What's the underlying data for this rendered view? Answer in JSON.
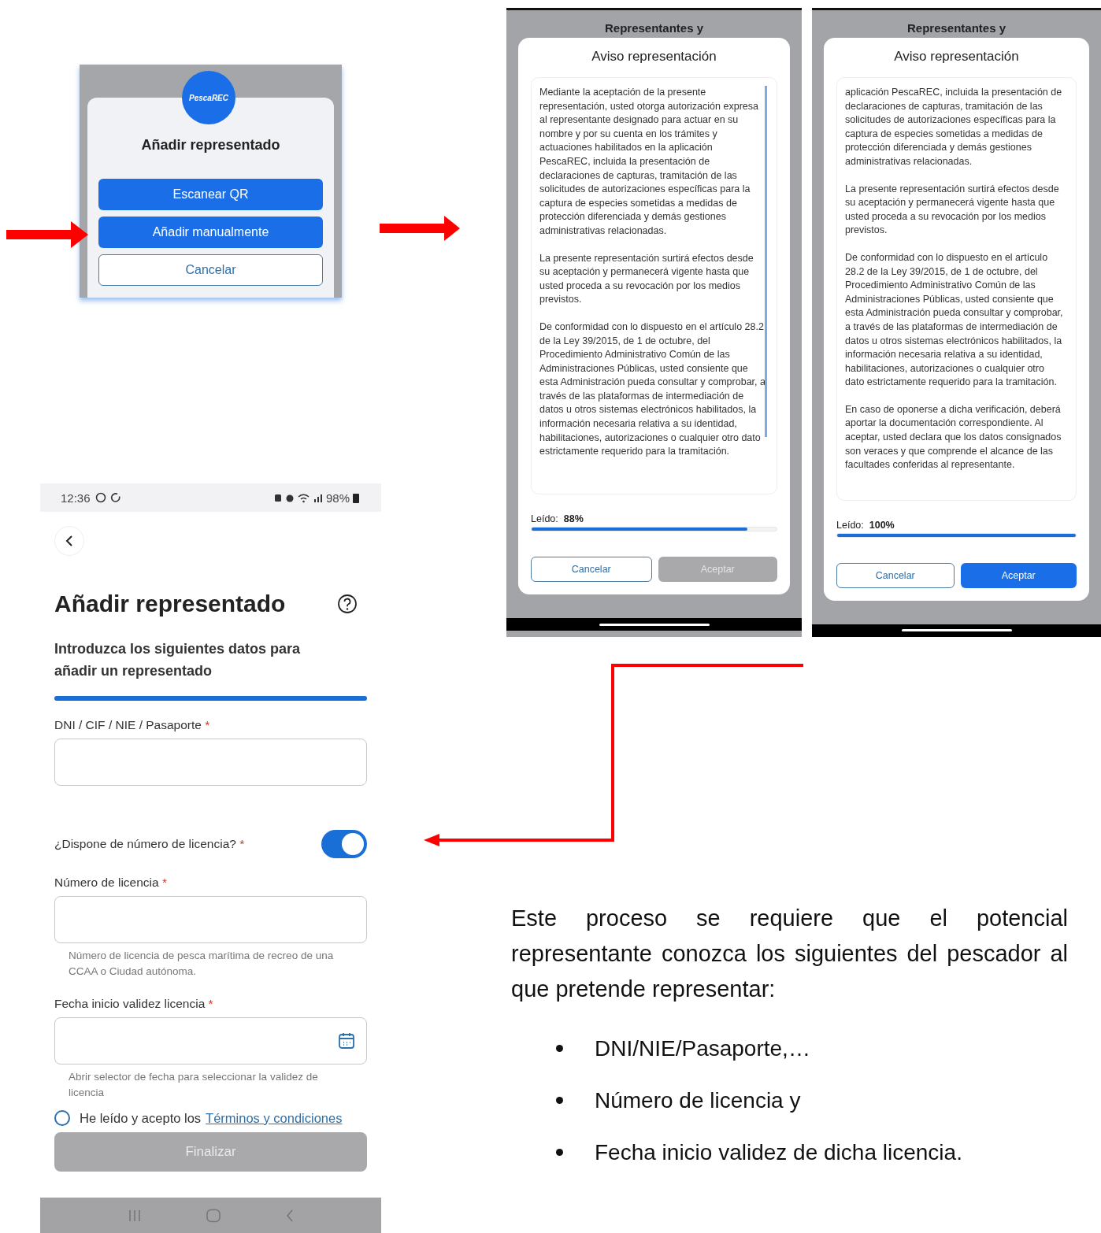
{
  "popup": {
    "logo": "PescaREC",
    "title": "Añadir representado",
    "buttons": [
      {
        "label": "Escanear QR",
        "kind": "primary"
      },
      {
        "label": "Añadir manualmente",
        "kind": "primary"
      },
      {
        "label": "Cancelar",
        "kind": "outline"
      }
    ]
  },
  "notice_screens": [
    {
      "header": "Representantes y",
      "title": "Aviso representación",
      "paragraphs": [
        "Mediante la aceptación de la presente representación, usted otorga autorización expresa al representante designado para actuar en su nombre y por su cuenta en los trámites y actuaciones habilitados en la aplicación PescaREC, incluida la presentación de declaraciones de capturas, tramitación de las solicitudes de autorizaciones específicas para la captura de especies sometidas a medidas de protección diferenciada y demás gestiones administrativas relacionadas.",
        "La presente representación surtirá efectos desde su aceptación y permanecerá vigente hasta que usted proceda a su revocación por los medios previstos.",
        "De conformidad con lo dispuesto en el artículo 28.2 de la Ley 39/2015, de 1 de octubre, del Procedimiento Administrativo Común de las Administraciones Públicas, usted consiente que esta Administración pueda consultar y comprobar, a través de las plataformas de intermediación de datos u otros sistemas electrónicos habilitados, la información necesaria relativa a su identidad, habilitaciones, autorizaciones o cualquier otro dato estrictamente requerido para la tramitación."
      ],
      "read_label": "Leído:",
      "read_value": "88%",
      "level": 0.88,
      "buttons": [
        {
          "label": "Cancelar",
          "kind": "outline",
          "disabled": false
        },
        {
          "label": "Aceptar",
          "kind": "primary",
          "disabled": true
        }
      ]
    },
    {
      "header": "Representantes y",
      "title": "Aviso representación",
      "paragraphs": [
        "aplicación PescaREC, incluida la presentación de declaraciones de capturas, tramitación de las solicitudes de autorizaciones específicas para la captura de especies sometidas a medidas de protección diferenciada y demás gestiones administrativas relacionadas.",
        "La presente representación surtirá efectos desde su aceptación y permanecerá vigente hasta que usted proceda a su revocación por los medios previstos.",
        "De conformidad con lo dispuesto en el artículo 28.2 de la Ley 39/2015, de 1 de octubre, del Procedimiento Administrativo Común de las Administraciones Públicas, usted consiente que esta Administración pueda consultar y comprobar, a través de las plataformas de intermediación de datos u otros sistemas electrónicos habilitados, la información necesaria relativa a su identidad, habilitaciones, autorizaciones o cualquier otro dato estrictamente requerido para la tramitación.",
        "En caso de oponerse a dicha verificación, deberá aportar la documentación correspondiente. Al aceptar, usted declara que los datos consignados son veraces y que comprende el alcance de las facultades conferidas al representante."
      ],
      "read_label": "Leído:",
      "read_value": "100%",
      "level": 1,
      "buttons": [
        {
          "label": "Cancelar",
          "kind": "outline",
          "disabled": false
        },
        {
          "label": "Aceptar",
          "kind": "primary",
          "disabled": false
        }
      ]
    }
  ],
  "form": {
    "status_bar": {
      "time": "12:36",
      "battery": "98%"
    },
    "title": "Añadir representado",
    "subtitle": "Introduzca los siguientes datos para añadir un representado",
    "progress": {
      "level": 1
    },
    "fields": [
      {
        "kind": "text",
        "label": "DNI / CIF / NIE / Pasaporte",
        "asterisk": "*"
      },
      {
        "kind": "toggle",
        "label": "¿Dispone de número de licencia?",
        "asterisk": "*",
        "on": true
      },
      {
        "kind": "text",
        "label": "Número de licencia",
        "asterisk": "*",
        "hint": "Número de licencia de pesca marítima de recreo de una CCAA o Ciudad autónoma."
      },
      {
        "kind": "date",
        "label": "Fecha inicio validez licencia",
        "asterisk": "*",
        "hint": "Abrir selector de fecha para seleccionar la validez de licencia"
      }
    ],
    "terms": {
      "checked": false,
      "text": "He leído y acepto los",
      "link": "Términos y condiciones"
    },
    "submit": {
      "label": "Finalizar",
      "disabled": true
    }
  },
  "description": {
    "paragraph": "Este proceso se requiere que el potencial representante conozca los siguientes del pescador al que pretende representar:",
    "bullets": [
      "DNI/NIE/Pasaporte,…",
      "Número de licencia y",
      "Fecha inicio validez de dicha licencia."
    ]
  }
}
